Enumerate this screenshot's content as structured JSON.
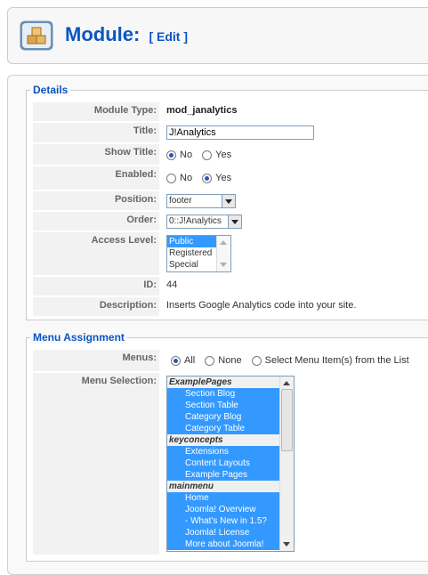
{
  "header": {
    "title": "Module:",
    "edit_tag": "[ Edit ]"
  },
  "details": {
    "legend": "Details",
    "module_type": {
      "label": "Module Type:",
      "value": "mod_janalytics"
    },
    "title": {
      "label": "Title:",
      "value": "J!Analytics"
    },
    "show_title": {
      "label": "Show Title:",
      "options": [
        "No",
        "Yes"
      ],
      "selected": "No"
    },
    "enabled": {
      "label": "Enabled:",
      "options": [
        "No",
        "Yes"
      ],
      "selected": "Yes"
    },
    "position": {
      "label": "Position:",
      "value": "footer"
    },
    "order": {
      "label": "Order:",
      "value": "0::J!Analytics"
    },
    "access_level": {
      "label": "Access Level:",
      "options": [
        "Public",
        "Registered",
        "Special"
      ],
      "selected": "Public"
    },
    "id": {
      "label": "ID:",
      "value": "44"
    },
    "description": {
      "label": "Description:",
      "value": "Inserts Google Analytics code into your site."
    }
  },
  "menu_assignment": {
    "legend": "Menu Assignment",
    "menus": {
      "label": "Menus:",
      "options": [
        "All",
        "None",
        "Select Menu Item(s) from the List"
      ],
      "selected": "All"
    },
    "menu_selection": {
      "label": "Menu Selection:",
      "items": [
        {
          "text": "ExamplePages",
          "kind": "group"
        },
        {
          "text": "Section Blog",
          "kind": "item"
        },
        {
          "text": "Section Table",
          "kind": "item"
        },
        {
          "text": "Category Blog",
          "kind": "item"
        },
        {
          "text": "Category Table",
          "kind": "item"
        },
        {
          "text": "keyconcepts",
          "kind": "group"
        },
        {
          "text": "Extensions",
          "kind": "item"
        },
        {
          "text": "Content Layouts",
          "kind": "item"
        },
        {
          "text": "Example Pages",
          "kind": "item"
        },
        {
          "text": "mainmenu",
          "kind": "group"
        },
        {
          "text": "Home",
          "kind": "item"
        },
        {
          "text": "Joomla! Overview",
          "kind": "item"
        },
        {
          "text": "- What's New in 1.5?",
          "kind": "subitem"
        },
        {
          "text": "Joomla! License",
          "kind": "item"
        },
        {
          "text": "More about Joomla!",
          "kind": "item"
        }
      ]
    }
  },
  "icons": {
    "module": "module-boxes-icon"
  },
  "colors": {
    "accent": "#0B55C4",
    "selection": "#3399ff"
  }
}
